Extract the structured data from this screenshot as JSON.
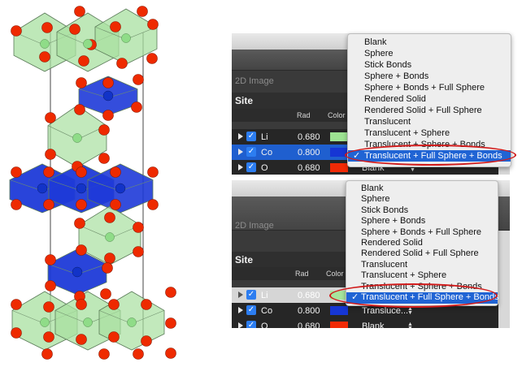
{
  "crystal": {
    "colors": {
      "lithium_octahedra": "#a8e0a0",
      "cobalt_octahedra": "#1e3ad8",
      "oxygen_atoms": "#ee2a00",
      "lithium_atoms": "#8fdc88",
      "cobalt_atoms": "#1233c8"
    }
  },
  "top_panel": {
    "tab_label": "2D Image",
    "site_title": "Site",
    "columns": {
      "rad": "Rad",
      "color": "Color"
    },
    "rows": [
      {
        "element": "Li",
        "rad": "0.680",
        "color": "#9de392"
      },
      {
        "element": "Co",
        "rad": "0.800",
        "color": "#1636d4"
      },
      {
        "element": "O",
        "rad": "0.680",
        "color": "#f22a06",
        "style": "Blank"
      }
    ],
    "menu": {
      "items": [
        "Blank",
        "Sphere",
        "Stick Bonds",
        "Sphere + Bonds",
        "Sphere + Bonds + Full Sphere",
        "Rendered Solid",
        "Rendered Solid + Full Sphere",
        "Translucent",
        "Translucent + Sphere",
        "Translucent + Sphere + Bonds",
        "Translucent + Full Sphere + Bonds"
      ],
      "selected_index": 10,
      "check_mark": "✓"
    }
  },
  "bottom_panel": {
    "tab_label": "2D Image",
    "site_title": "Site",
    "columns": {
      "rad": "Rad",
      "color": "Color"
    },
    "rows": [
      {
        "element": "Li",
        "rad": "0.680",
        "color": "#a7e69c"
      },
      {
        "element": "Co",
        "rad": "0.800",
        "color": "#1636d4",
        "style": "Transluce..."
      },
      {
        "element": "O",
        "rad": "0.680",
        "color": "#f22a06",
        "style": "Blank"
      }
    ],
    "menu": {
      "items": [
        "Blank",
        "Sphere",
        "Stick Bonds",
        "Sphere + Bonds",
        "Sphere + Bonds + Full Sphere",
        "Rendered Solid",
        "Rendered Solid + Full Sphere",
        "Translucent",
        "Translucent + Sphere",
        "Translucent + Sphere + Bonds",
        "Translucent + Full Sphere + Bonds"
      ],
      "selected_index": 10,
      "check_mark": "✓"
    }
  },
  "checkbox_glyph": "✓",
  "highlight_color": "#d11a1a"
}
